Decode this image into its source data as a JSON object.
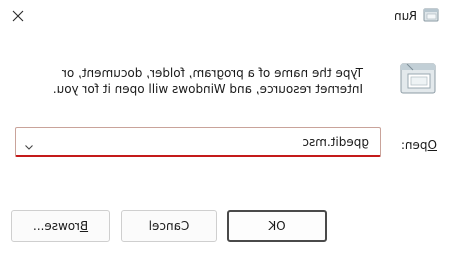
{
  "window": {
    "title": "Run",
    "close_icon": "close-icon",
    "title_icon": "run-icon"
  },
  "description": {
    "line1": "Type the name of a program, folder, document, or",
    "line2": "Internet resource, and Windows will open it for you.",
    "icon": "run-icon"
  },
  "open": {
    "label_mnemonic": "O",
    "label_rest": "pen:",
    "value": "gpedit.msc",
    "dropdown_icon": "chevron-down-icon",
    "accent_color": "#c41a1a"
  },
  "buttons": {
    "ok": "OK",
    "cancel": "Cancel",
    "browse_mnemonic": "B",
    "browse_rest": "rowse..."
  }
}
